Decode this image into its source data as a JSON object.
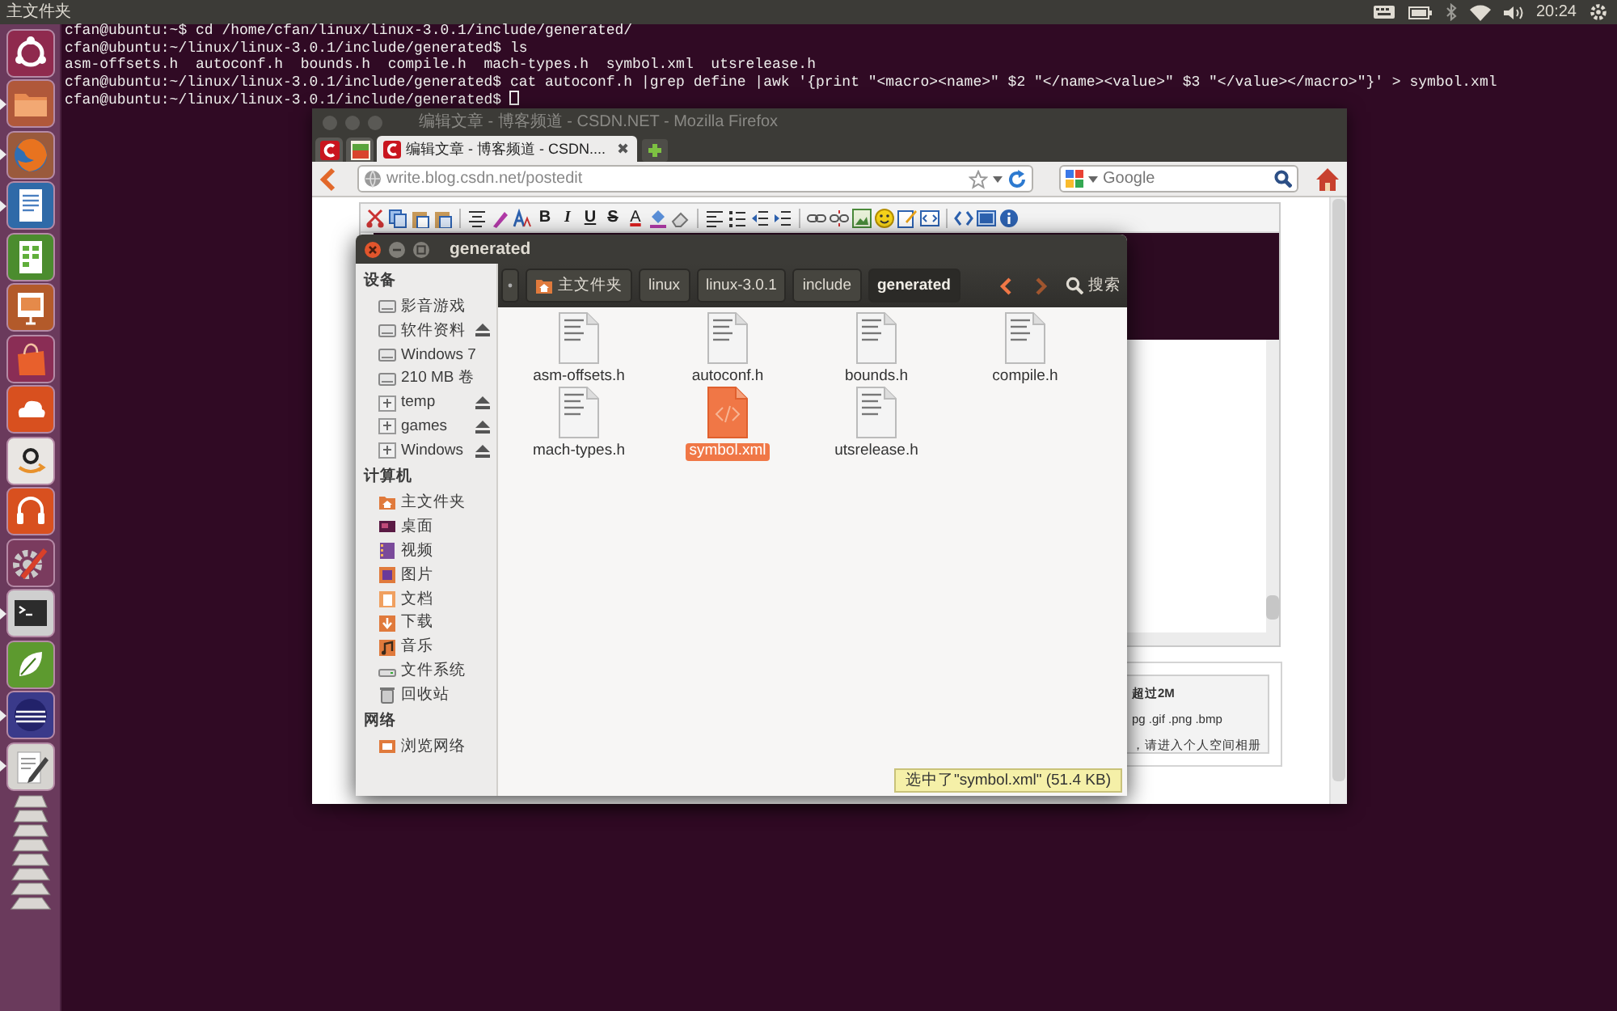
{
  "top_panel": {
    "title": "主文件夹",
    "clock": "20:24"
  },
  "launcher": [
    {
      "kind": "ubuntu",
      "running": false
    },
    {
      "kind": "files",
      "running": true
    },
    {
      "kind": "firefox",
      "running": true
    },
    {
      "kind": "writer",
      "running": true
    },
    {
      "kind": "calc",
      "running": false
    },
    {
      "kind": "impress",
      "running": false
    },
    {
      "kind": "store",
      "running": false
    },
    {
      "kind": "one",
      "running": false
    },
    {
      "kind": "amazon",
      "running": false
    },
    {
      "kind": "music",
      "running": false
    },
    {
      "kind": "settings",
      "running": false
    },
    {
      "kind": "terminal",
      "running": true
    },
    {
      "kind": "qt",
      "running": false
    },
    {
      "kind": "eclipse",
      "running": true
    },
    {
      "kind": "editor",
      "running": true
    },
    {
      "kind": "stack",
      "running": false
    }
  ],
  "terminal": {
    "lines": [
      "cfan@ubuntu:~$ cd /home/cfan/linux/linux-3.0.1/include/generated/",
      "cfan@ubuntu:~/linux/linux-3.0.1/include/generated$ ls",
      "asm-offsets.h  autoconf.h  bounds.h  compile.h  mach-types.h  symbol.xml  utsrelease.h",
      "cfan@ubuntu:~/linux/linux-3.0.1/include/generated$ cat autoconf.h |grep define |awk '{print \"<macro><name>\" $2 \"</name><value>\" $3 \"</value></macro>\"}' > symbol.xml",
      "cfan@ubuntu:~/linux/linux-3.0.1/include/generated$ "
    ]
  },
  "firefox": {
    "title": "编辑文章 - 博客频道 - CSDN.NET - Mozilla Firefox",
    "tabs": [
      {
        "kind": "pinned",
        "selected": false
      },
      {
        "kind": "pinned",
        "selected": false
      },
      {
        "kind": "page",
        "label": "编辑文章 - 博客频道 - CSDN....",
        "close": "✖",
        "selected": true
      }
    ],
    "url": "write.blog.csdn.net/postedit",
    "search": {
      "placeholder": "Google"
    },
    "format_buttons": [
      "B",
      "I",
      "U",
      "S",
      "A"
    ],
    "upload": {
      "size_note": "超过2M",
      "types": "pg .gif .png .bmp",
      "hint": "，请进入",
      "link": "个人空间相册"
    }
  },
  "file_manager": {
    "title": "generated",
    "path": [
      {
        "label": "主文件夹",
        "kind": "home",
        "selected": false
      },
      {
        "label": "linux",
        "kind": "folder",
        "selected": false
      },
      {
        "label": "linux-3.0.1",
        "kind": "folder",
        "selected": false
      },
      {
        "label": "include",
        "kind": "folder",
        "selected": false
      },
      {
        "label": "generated",
        "kind": "folder",
        "selected": true
      }
    ],
    "search_label": "搜索",
    "sidebar": [
      {
        "heading": "设备",
        "items": [
          {
            "label": "影音游戏",
            "kind": "drive",
            "eject": false
          },
          {
            "label": "软件资料",
            "kind": "drive",
            "eject": true
          },
          {
            "label": "Windows 7",
            "kind": "drive",
            "eject": false
          },
          {
            "label": "210 MB 卷",
            "kind": "drive",
            "eject": false
          },
          {
            "label": "temp",
            "kind": "mount",
            "eject": true
          },
          {
            "label": "games",
            "kind": "mount",
            "eject": true
          },
          {
            "label": "Windows",
            "kind": "mount",
            "eject": true
          }
        ]
      },
      {
        "heading": "计算机",
        "items": [
          {
            "label": "主文件夹",
            "kind": "home",
            "eject": false
          },
          {
            "label": "桌面",
            "kind": "desktop",
            "eject": false
          },
          {
            "label": "视频",
            "kind": "video",
            "eject": false
          },
          {
            "label": "图片",
            "kind": "pictures",
            "eject": false
          },
          {
            "label": "文档",
            "kind": "documents",
            "eject": false
          },
          {
            "label": "下载",
            "kind": "downloads",
            "eject": false
          },
          {
            "label": "音乐",
            "kind": "music",
            "eject": false
          },
          {
            "label": "文件系统",
            "kind": "filesystem",
            "eject": false
          },
          {
            "label": "回收站",
            "kind": "trash",
            "eject": false
          }
        ]
      },
      {
        "heading": "网络",
        "items": [
          {
            "label": "浏览网络",
            "kind": "network",
            "eject": false
          }
        ]
      }
    ],
    "files": [
      {
        "name": "asm-offsets.h",
        "kind": "text",
        "selected": false
      },
      {
        "name": "autoconf.h",
        "kind": "text",
        "selected": false
      },
      {
        "name": "bounds.h",
        "kind": "text",
        "selected": false
      },
      {
        "name": "compile.h",
        "kind": "text",
        "selected": false
      },
      {
        "name": "mach-types.h",
        "kind": "text",
        "selected": false
      },
      {
        "name": "symbol.xml",
        "kind": "xml",
        "selected": true
      },
      {
        "name": "utsrelease.h",
        "kind": "text",
        "selected": false
      }
    ],
    "status": "选中了\"symbol.xml\" (51.4 KB)"
  }
}
